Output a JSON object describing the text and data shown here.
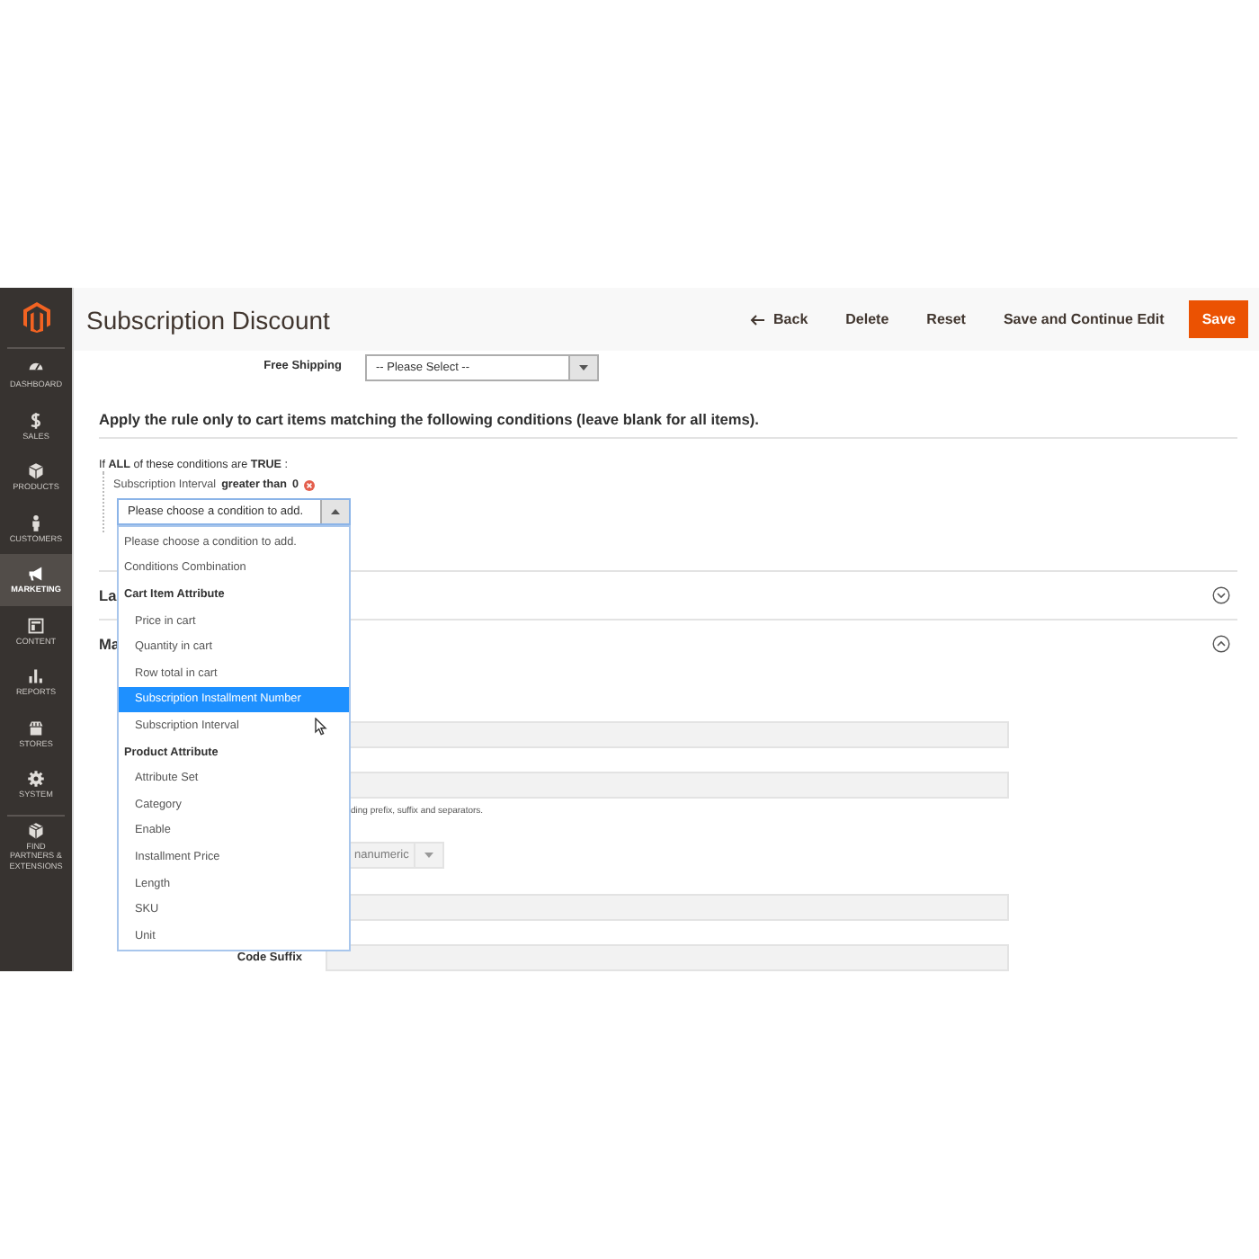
{
  "sidebar": {
    "items": [
      {
        "label": "DASHBOARD",
        "selected": false
      },
      {
        "label": "SALES",
        "selected": false
      },
      {
        "label": "PRODUCTS",
        "selected": false
      },
      {
        "label": "CUSTOMERS",
        "selected": false
      },
      {
        "label": "MARKETING",
        "selected": true
      },
      {
        "label": "CONTENT",
        "selected": false
      },
      {
        "label": "REPORTS",
        "selected": false
      },
      {
        "label": "STORES",
        "selected": false
      },
      {
        "label": "SYSTEM",
        "selected": false
      },
      {
        "label": "FIND PARTNERS & EXTENSIONS",
        "selected": false
      }
    ]
  },
  "header": {
    "title": "Subscription Discount",
    "buttons": [
      {
        "label": "Back",
        "kind": "back"
      },
      {
        "label": "Delete",
        "kind": "plain"
      },
      {
        "label": "Reset",
        "kind": "plain"
      },
      {
        "label": "Save and Continue Edit",
        "kind": "plain"
      },
      {
        "label": "Save",
        "kind": "primary"
      }
    ]
  },
  "free_shipping": {
    "label": "Free Shipping",
    "value": "-- Please Select --"
  },
  "conditions": {
    "heading": "Apply the rule only to cart items matching the following conditions (leave blank for all items).",
    "rule_text": "If **ALL**  of these conditions are **TRUE** :",
    "condition": {
      "attribute": "Subscription Interval",
      "operator": "greater than",
      "value": "0"
    },
    "select": {
      "value": "Please choose a condition to add.",
      "expanded": true
    },
    "options": [
      {
        "label": "Please choose a condition to add.",
        "kind": "option",
        "selected": false
      },
      {
        "label": "Conditions Combination",
        "kind": "option",
        "selected": false
      },
      {
        "label": "Cart Item Attribute",
        "kind": "group",
        "selected": false
      },
      {
        "label": "Price in cart",
        "kind": "suboption",
        "selected": false
      },
      {
        "label": "Quantity in cart",
        "kind": "suboption",
        "selected": false
      },
      {
        "label": "Row total in cart",
        "kind": "suboption",
        "selected": false
      },
      {
        "label": "Subscription Installment Number",
        "kind": "suboption",
        "selected": true
      },
      {
        "label": "Subscription Interval",
        "kind": "suboption",
        "selected": false
      },
      {
        "label": "Product Attribute",
        "kind": "group",
        "selected": false
      },
      {
        "label": "Attribute Set",
        "kind": "suboption",
        "selected": false
      },
      {
        "label": "Category",
        "kind": "suboption",
        "selected": false
      },
      {
        "label": "Enable",
        "kind": "suboption",
        "selected": false
      },
      {
        "label": "Installment Price",
        "kind": "suboption",
        "selected": false
      },
      {
        "label": "Length",
        "kind": "suboption",
        "selected": false
      },
      {
        "label": "SKU",
        "kind": "suboption",
        "selected": false
      },
      {
        "label": "Unit",
        "kind": "suboption",
        "selected": false
      }
    ]
  },
  "sections": [
    {
      "title": "La",
      "expanded": false
    },
    {
      "title": "Ma",
      "expanded": true
    }
  ],
  "form_rows": [
    {
      "kind": "input"
    },
    {
      "kind": "input",
      "hint": "ding prefix, suffix and separators."
    },
    {
      "kind": "select",
      "value": "nanumeric"
    },
    {
      "kind": "input"
    },
    {
      "kind": "input",
      "label": "Code Suffix"
    }
  ]
}
